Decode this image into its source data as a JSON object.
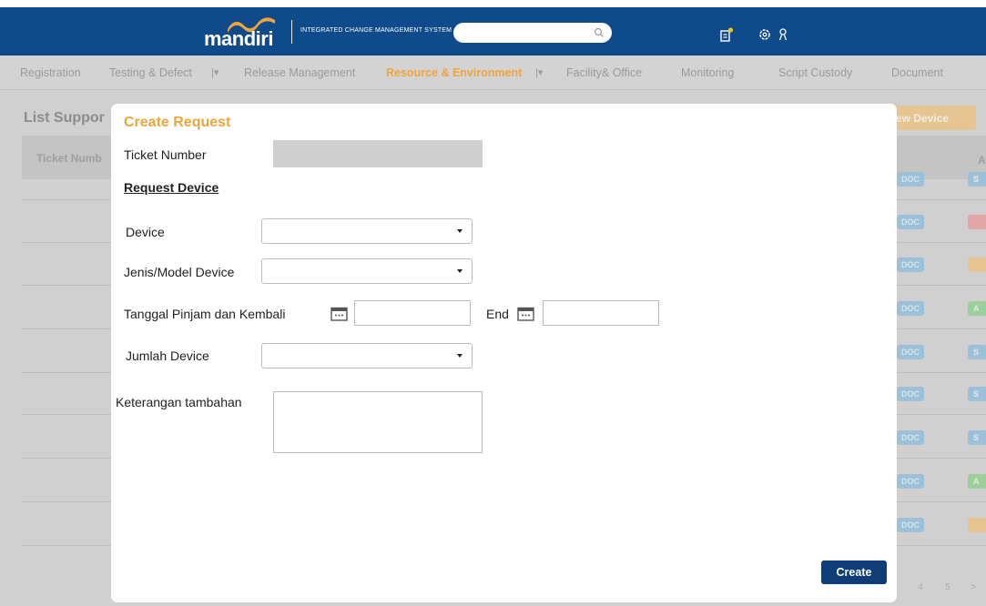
{
  "header": {
    "logo_text": "mandiri",
    "system_name": "INTEGRATED CHANGE MANAGEMENT SYSTEM",
    "search_placeholder": "",
    "icons": [
      "notification-icon",
      "settings-icon",
      "user-icon"
    ],
    "brand_color": "#0f4a8a",
    "logo_wave_color": "#f0a43a"
  },
  "nav": {
    "items": [
      {
        "label": "Registration",
        "dropdown": false
      },
      {
        "label": "Testing & Defect",
        "dropdown": true
      },
      {
        "label": "Release  Management",
        "dropdown": false
      },
      {
        "label": "Resource & Environment",
        "dropdown": true,
        "active": true
      },
      {
        "label": "Facility& Office",
        "dropdown": false
      },
      {
        "label": "Monitoring",
        "dropdown": false
      },
      {
        "label": "Script Custody",
        "dropdown": false
      },
      {
        "label": "Document",
        "dropdown": false
      }
    ],
    "active_color": "#f0a43a"
  },
  "background": {
    "title": "List Suppor",
    "add_button_label": "ew Device",
    "table_header": [
      "Ticket Numb",
      "A"
    ],
    "rows": [
      {
        "badge": "DOC",
        "status": "S",
        "status_color": "#9cc0d8"
      },
      {
        "badge": "DOC",
        "status": "",
        "status_color": "#e2a6a6"
      },
      {
        "badge": "DOC",
        "status": "",
        "status_color": "#e6c592"
      },
      {
        "badge": "DOC",
        "status": "A",
        "status_color": "#9ccf9a"
      },
      {
        "badge": "DOC",
        "status": "S",
        "status_color": "#9cc0d8"
      },
      {
        "badge": "DOC",
        "status": "S",
        "status_color": "#9cc0d8"
      },
      {
        "badge": "DOC",
        "status": "S",
        "status_color": "#9cc0d8"
      },
      {
        "badge": "DOC",
        "status": "A",
        "status_color": "#9ccf9a"
      },
      {
        "badge": "DOC",
        "status": "",
        "status_color": "#e6c592"
      }
    ],
    "pagination": [
      "4",
      "5",
      ">"
    ]
  },
  "modal": {
    "title": "Create Request",
    "ticket_label": "Ticket Number",
    "ticket_value": "",
    "section_title": "Request Device",
    "device_label": "Device",
    "device_value": "",
    "model_label": "Jenis/Model Device",
    "model_value": "",
    "date_label": "Tanggal Pinjam dan Kembali",
    "start_date_value": "",
    "end_label": "End",
    "end_date_value": "",
    "qty_label": "Jumlah Device",
    "qty_value": "",
    "notes_label": "Keterangan tambahan",
    "notes_value": "",
    "create_label": "Create",
    "title_color": "#f0a43a",
    "button_color": "#0f3d78"
  }
}
